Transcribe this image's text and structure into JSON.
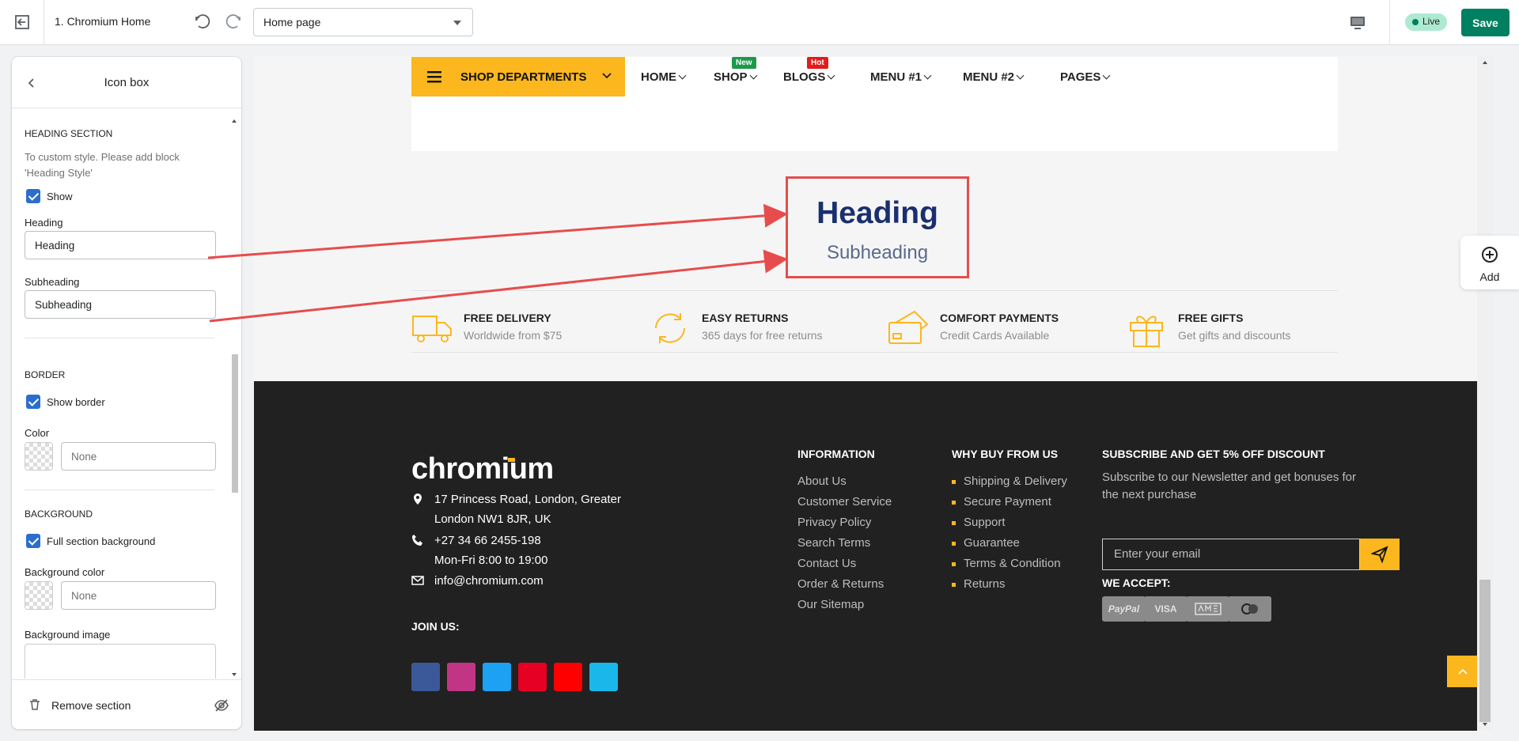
{
  "topbar": {
    "theme_name": "1. Chromium Home",
    "page_select": "Home page",
    "live_label": "Live",
    "save_label": "Save"
  },
  "panel": {
    "title": "Icon box",
    "heading_section": {
      "title": "HEADING SECTION",
      "help": "To custom style. Please add block 'Heading Style'",
      "show_label": "Show",
      "show_checked": true,
      "heading_label": "Heading",
      "heading_value": "Heading",
      "subheading_label": "Subheading",
      "subheading_value": "Subheading"
    },
    "border": {
      "title": "BORDER",
      "show_border_label": "Show border",
      "show_border_checked": true,
      "color_label": "Color",
      "color_placeholder": "None"
    },
    "background": {
      "title": "BACKGROUND",
      "full_label": "Full section background",
      "full_checked": true,
      "bgcolor_label": "Background color",
      "bgcolor_placeholder": "None",
      "bgimage_label": "Background image"
    },
    "remove_label": "Remove section"
  },
  "preview": {
    "nav": {
      "departments": "SHOP DEPARTMENTS",
      "items": [
        "HOME",
        "SHOP",
        "BLOGS",
        "MENU #1",
        "MENU #2",
        "PAGES"
      ],
      "badge_new": "New",
      "badge_hot": "Hot"
    },
    "heading": "Heading",
    "subheading": "Subheading",
    "features": [
      {
        "title": "FREE DELIVERY",
        "sub": "Worldwide from $75",
        "icon": "truck-icon"
      },
      {
        "title": "EASY RETURNS",
        "sub": "365 days for free returns",
        "icon": "returns-icon"
      },
      {
        "title": "COMFORT PAYMENTS",
        "sub": "Credit Cards Available",
        "icon": "card-icon"
      },
      {
        "title": "FREE GIFTS",
        "sub": "Get gifts and discounts",
        "icon": "gift-icon"
      }
    ],
    "footer": {
      "logo": "chromium",
      "address_l1": "17 Princess Road, London, Greater",
      "address_l2": "London NW1 8JR, UK",
      "phone_l1": "+27 34 66 2455-198",
      "phone_l2": "Mon-Fri 8:00 to 19:00",
      "email": "info@chromium.com",
      "join": "JOIN US:",
      "info_title": "INFORMATION",
      "info_links": [
        "About Us",
        "Customer Service",
        "Privacy Policy",
        "Search Terms",
        "Contact Us",
        "Order & Returns",
        "Our Sitemap"
      ],
      "why_title": "WHY BUY FROM US",
      "why_links": [
        "Shipping & Delivery",
        "Secure Payment",
        "Support",
        "Guarantee",
        "Terms & Condition",
        "Returns"
      ],
      "sub_title": "SUBSCRIBE AND GET 5% OFF DISCOUNT",
      "sub_text": "Subscribe to our Newsletter and get bonuses for the next purchase",
      "email_placeholder": "Enter your email",
      "accept_title": "WE ACCEPT:",
      "payments": [
        "PayPal",
        "VISA"
      ]
    },
    "add_label": "Add"
  },
  "colors": {
    "accent": "#fbb71d",
    "save": "#008060",
    "annotation": "#e74c4c",
    "heading": "#1a2f6e"
  }
}
